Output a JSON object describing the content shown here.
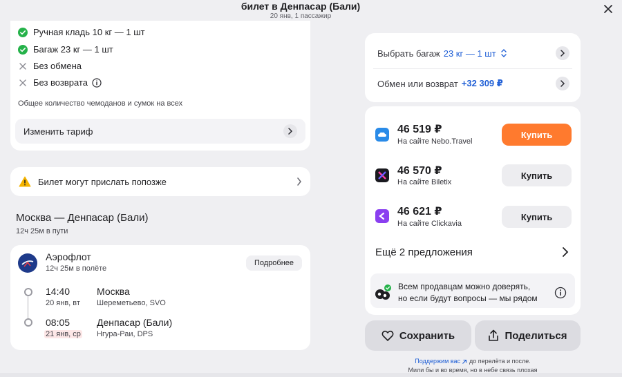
{
  "header": {
    "title": "билет в Денпасар (Бали)",
    "subtitle": "20 янв, 1 пассажир"
  },
  "tariff": {
    "features": [
      {
        "label": "Ручная кладь 10 кг — 1 шт",
        "status": "included",
        "icon": "check-icon"
      },
      {
        "label": "Багаж 23 кг — 1 шт",
        "status": "included",
        "icon": "check-icon"
      },
      {
        "label": "Без обмена",
        "status": "excluded",
        "icon": "cross-icon"
      },
      {
        "label": "Без возврата",
        "status": "excluded",
        "icon": "cross-icon"
      }
    ],
    "note": "Общее количество чемоданов и сумок на всех",
    "change_label": "Изменить тариф"
  },
  "warning": {
    "text": "Билет могут прислать попозже"
  },
  "route": {
    "title": "Москва — Денпасар (Бали)",
    "duration": "12ч 25м в пути"
  },
  "flight": {
    "airline": "Аэрофлот",
    "duration": "12ч 25м в полёте",
    "details_label": "Подробнее",
    "departure": {
      "time": "14:40",
      "date": "20 янв, вт",
      "city": "Москва",
      "airport": "Шереметьево, SVO"
    },
    "arrival": {
      "time": "08:05",
      "date": "21 янв, ср",
      "city": "Денпасар (Бали)",
      "airport": "Нгура-Раи, DPS"
    }
  },
  "options": {
    "baggage_prefix": "Выбрать багаж",
    "baggage_value": "23 кг — 1 шт",
    "exchange_prefix": "Обмен или возврат",
    "exchange_value": "+32 309 ₽"
  },
  "offers": [
    {
      "price": "46 519 ₽",
      "seller": "На сайте Nebo.Travel",
      "buy_label": "Купить",
      "primary": true
    },
    {
      "price": "46 570 ₽",
      "seller": "На сайте Biletix",
      "buy_label": "Купить",
      "primary": false
    },
    {
      "price": "46 621 ₽",
      "seller": "На сайте Clickavia",
      "buy_label": "Купить",
      "primary": false
    }
  ],
  "more_offers": "Ещё 2 предложения",
  "trust": {
    "line1": "Всем продавцам можно доверять,",
    "line2": "но если будут вопросы — мы рядом"
  },
  "actions": {
    "save": "Сохранить",
    "share": "Поделиться"
  },
  "footer": {
    "link": "Поддержим вас",
    "line1_rest": " до перелёта и после.",
    "line2": "Мили бы и во время, но в небе связь плохая"
  },
  "colors": {
    "accent_orange": "#ff7a2e",
    "check_green": "#25b24a",
    "link_blue": "#2160d6",
    "warning_yellow": "#f5b400"
  }
}
